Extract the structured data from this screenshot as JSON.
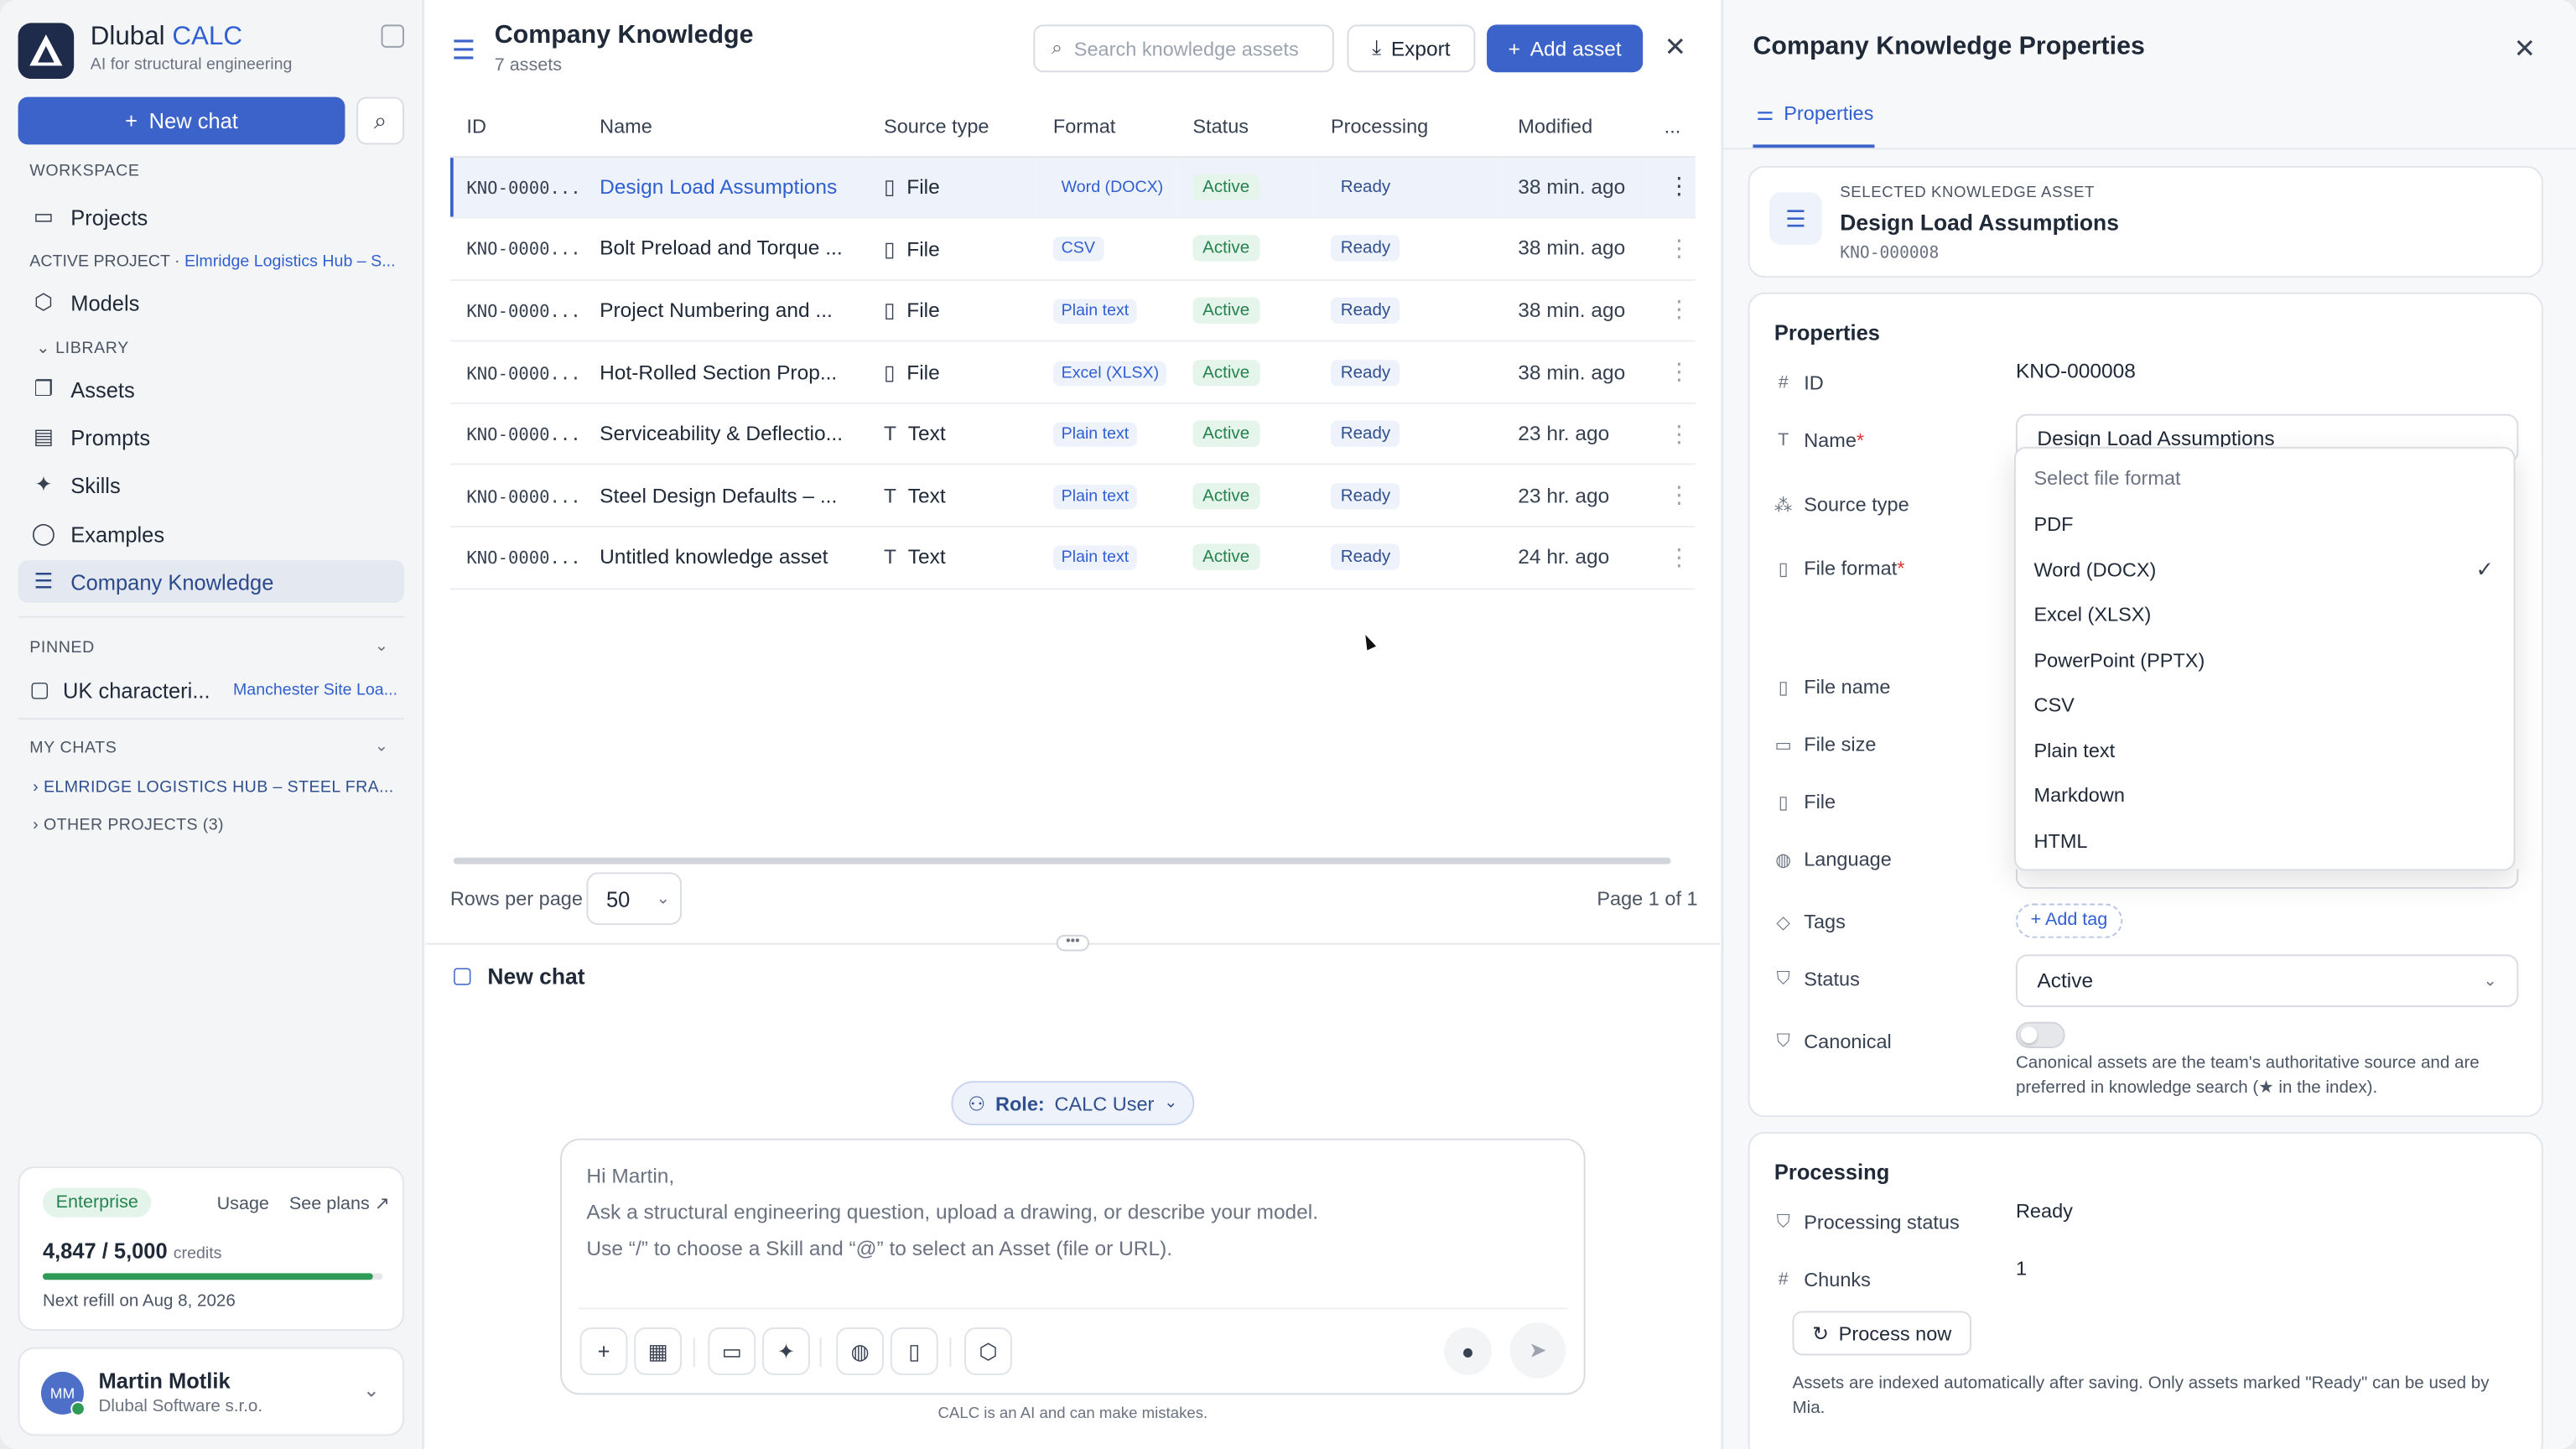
{
  "app": {
    "name": "Dlubal",
    "name_accent": "CALC",
    "subtitle": "AI for structural engineering",
    "new_chat": "New chat"
  },
  "sidebar": {
    "workspace": "WORKSPACE",
    "projects": "Projects",
    "active_project_label": "ACTIVE PROJECT",
    "active_project_name": "Elmridge Logistics Hub – S...",
    "models": "Models",
    "library": "LIBRARY",
    "items": [
      {
        "label": "Assets",
        "icon": "copy-icon"
      },
      {
        "label": "Prompts",
        "icon": "prompt-icon"
      },
      {
        "label": "Skills",
        "icon": "sparkles-icon"
      },
      {
        "label": "Examples",
        "icon": "bulb-icon"
      },
      {
        "label": "Company Knowledge",
        "icon": "database-icon"
      }
    ],
    "pinned": "PINNED",
    "pinned_chat": "UK characteri...",
    "pinned_chat_project": "Manchester Site Loa...",
    "my_chats": "MY CHATS",
    "groups": [
      "ELMRIDGE LOGISTICS HUB – STEEL FRA...",
      "OTHER PROJECTS (3)"
    ],
    "plan": "Enterprise",
    "usage": "Usage",
    "see_plans": "See plans",
    "credits": "4,847 / 5,000",
    "credits_unit": "credits",
    "credits_fraction": 0.969,
    "refill": "Next refill on Aug 8, 2026",
    "user_initials": "MM",
    "user_name": "Martin Motlik",
    "user_org": "Dlubal Software s.r.o."
  },
  "main": {
    "title": "Company Knowledge",
    "count": "7 assets",
    "search_placeholder": "Search knowledge assets",
    "export": "Export",
    "add": "Add asset",
    "columns": [
      "ID",
      "Name",
      "Source type",
      "Format",
      "Status",
      "Processing",
      "Modified",
      "..."
    ],
    "rows": [
      {
        "id": "KNO-0000...",
        "name": "Design Load Assumptions",
        "source": "File",
        "source_icon": "file-icon",
        "format": "Word (DOCX)",
        "status": "Active",
        "processing": "Ready",
        "modified": "38 min. ago"
      },
      {
        "id": "KNO-0000...",
        "name": "Bolt Preload and Torque ...",
        "source": "File",
        "source_icon": "file-icon",
        "format": "CSV",
        "status": "Active",
        "processing": "Ready",
        "modified": "38 min. ago"
      },
      {
        "id": "KNO-0000...",
        "name": "Project Numbering and ...",
        "source": "File",
        "source_icon": "file-icon",
        "format": "Plain text",
        "status": "Active",
        "processing": "Ready",
        "modified": "38 min. ago"
      },
      {
        "id": "KNO-0000...",
        "name": "Hot-Rolled Section Prop...",
        "source": "File",
        "source_icon": "file-icon",
        "format": "Excel (XLSX)",
        "status": "Active",
        "processing": "Ready",
        "modified": "38 min. ago"
      },
      {
        "id": "KNO-0000...",
        "name": "Serviceability & Deflectio...",
        "source": "Text",
        "source_icon": "text-icon",
        "format": "Plain text",
        "status": "Active",
        "processing": "Ready",
        "modified": "23 hr. ago"
      },
      {
        "id": "KNO-0000...",
        "name": "Steel Design Defaults – ...",
        "source": "Text",
        "source_icon": "text-icon",
        "format": "Plain text",
        "status": "Active",
        "processing": "Ready",
        "modified": "23 hr. ago"
      },
      {
        "id": "KNO-0000...",
        "name": "Untitled knowledge asset",
        "source": "Text",
        "source_icon": "text-icon",
        "format": "Plain text",
        "status": "Active",
        "processing": "Ready",
        "modified": "24 hr. ago"
      }
    ],
    "rows_per_page_label": "Rows per page",
    "rows_per_page": "50",
    "page": "Page 1 of 1"
  },
  "chat": {
    "title": "New chat",
    "role_label": "Role:",
    "role": "CALC User",
    "lines": [
      "Hi Martin,",
      "Ask a structural engineering question, upload a drawing, or describe your model.",
      "Use “/” to choose a Skill and “@” to select an Asset (file or URL)."
    ],
    "disclaimer": "CALC is an AI and can make mistakes."
  },
  "panel": {
    "title": "Company Knowledge Properties",
    "tab": "Properties",
    "selected_label": "SELECTED KNOWLEDGE ASSET",
    "selected_name": "Design Load Assumptions",
    "selected_id": "KNO-000008",
    "properties_heading": "Properties",
    "labels": {
      "id": "ID",
      "name": "Name",
      "source_type": "Source type",
      "file_format": "File format",
      "file_name": "File name",
      "file_size": "File size",
      "file": "File",
      "language": "Language",
      "tags": "Tags",
      "status": "Status",
      "canonical": "Canonical"
    },
    "id_value": "KNO-000008",
    "name_value": "Design Load Assumptions",
    "add_tag": "+ Add tag",
    "status_value": "Active",
    "canonical_note": "Canonical assets are the team's authoritative source and are preferred in knowledge search (★ in the index).",
    "dropdown_header": "Select file format",
    "formats": [
      "PDF",
      "Word (DOCX)",
      "Excel (XLSX)",
      "PowerPoint (PPTX)",
      "CSV",
      "Plain text",
      "Markdown",
      "HTML"
    ],
    "selected_format": "Word (DOCX)",
    "processing_heading": "Processing",
    "processing_status_label": "Processing status",
    "processing_status": "Ready",
    "chunks_label": "Chunks",
    "chunks": "1",
    "process_now": "Process now",
    "processing_note": "Assets are indexed automatically after saving. Only assets marked \"Ready\" can be used by Mia."
  },
  "colors": {
    "accent": "#3b63c9",
    "success": "#25834f"
  }
}
